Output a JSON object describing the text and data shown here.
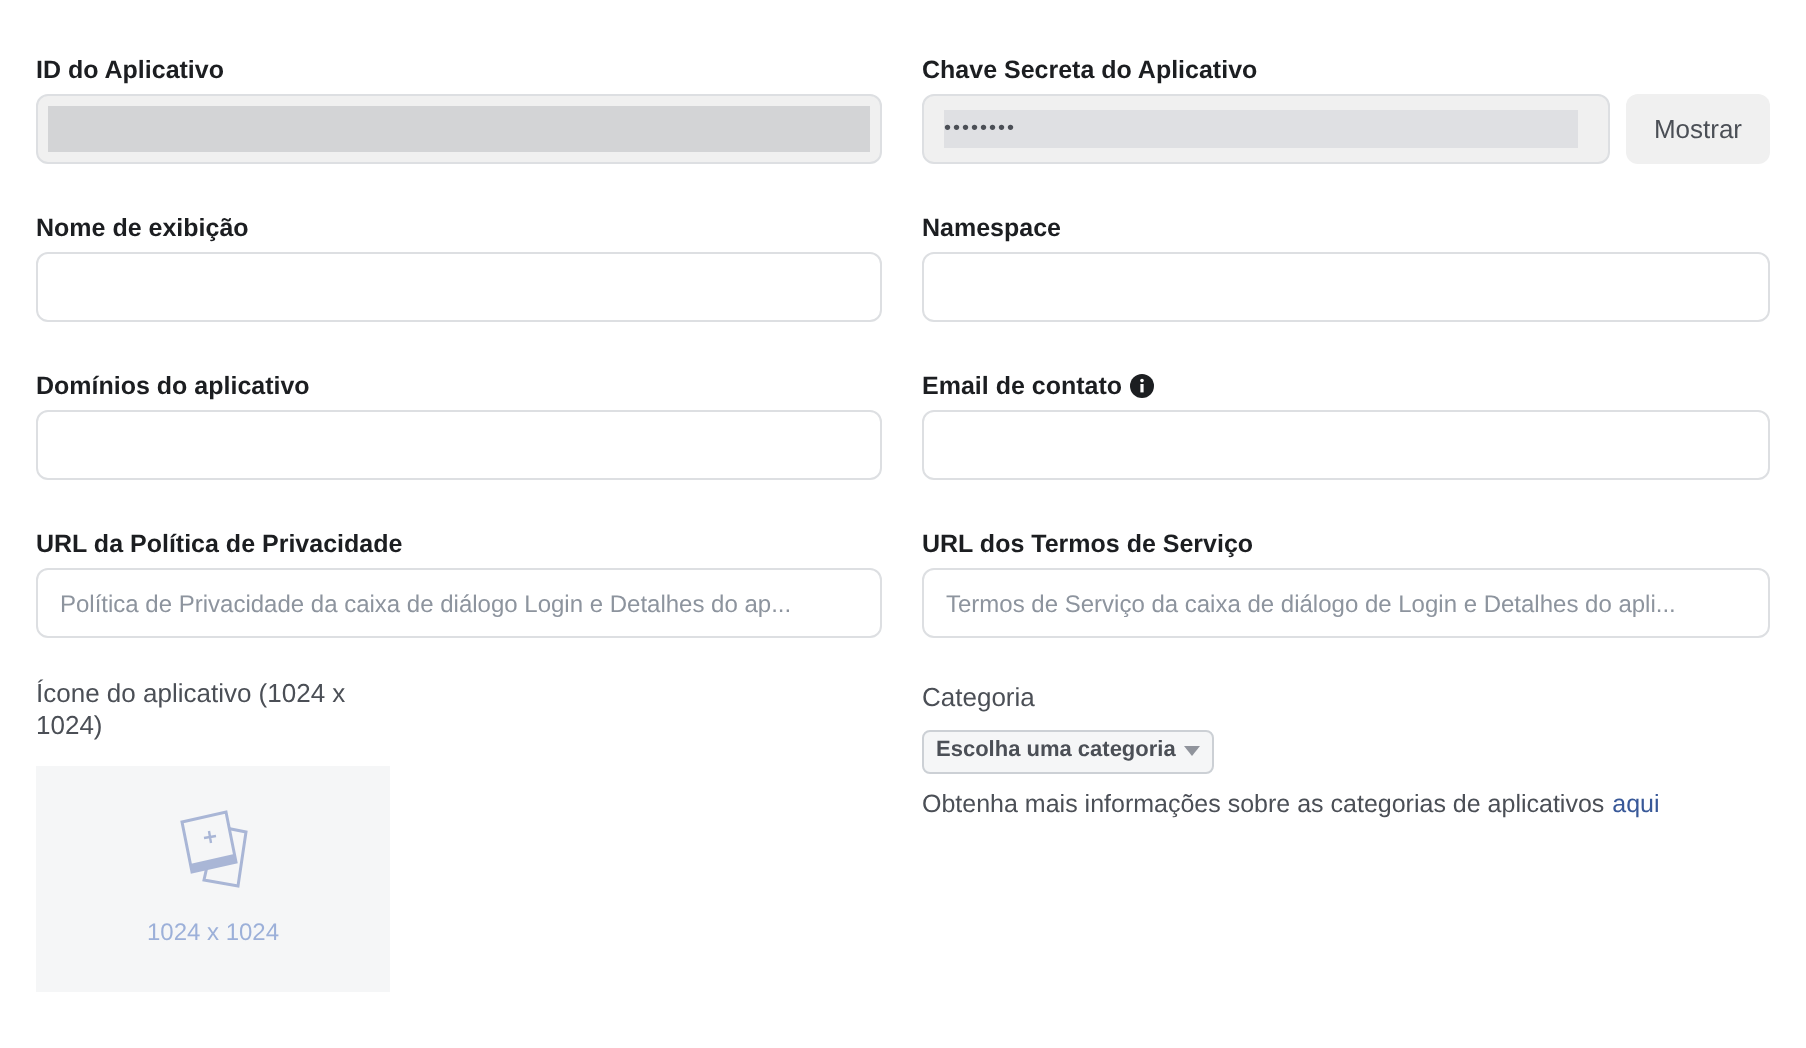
{
  "left": [
    {
      "kind": "redacted",
      "label": "ID do Aplicativo"
    },
    {
      "kind": "text",
      "label": "Nome de exibição"
    },
    {
      "kind": "text",
      "label": "Domínios do aplicativo"
    },
    {
      "kind": "text",
      "label": "URL da Política de Privacidade",
      "placeholder": "Política de Privacidade da caixa de diálogo Login e Detalhes do ap..."
    }
  ],
  "right": [
    {
      "kind": "secret",
      "label": "Chave Secreta do Aplicativo",
      "value": "••••••••",
      "button": "Mostrar"
    },
    {
      "kind": "text",
      "label": "Namespace"
    },
    {
      "kind": "text",
      "label": "Email de contato",
      "info": true
    },
    {
      "kind": "text",
      "label": "URL dos Termos de Serviço",
      "placeholder": "Termos de Serviço da caixa de diálogo de Login e Detalhes do apli..."
    }
  ],
  "icon_upload": {
    "label": "Ícone do aplicativo (1024 x 1024)",
    "size": "1024 x 1024"
  },
  "category": {
    "label": "Categoria",
    "dropdown": "Escolha uma categoria",
    "help": "Obtenha mais informações sobre as categorias de aplicativos",
    "link": "aqui"
  }
}
